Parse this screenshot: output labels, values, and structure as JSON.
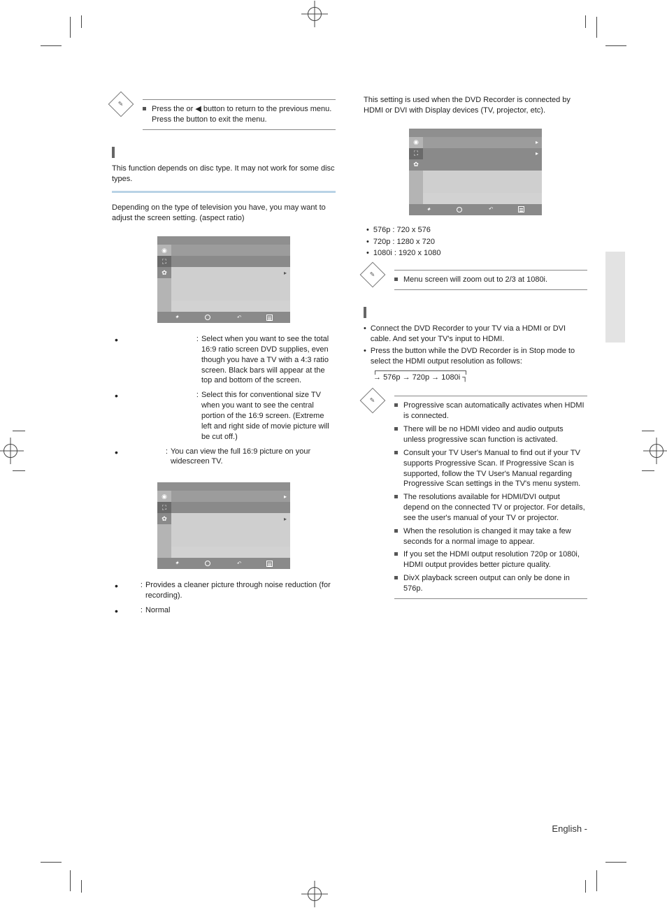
{
  "note1": {
    "item1_a": "Press the ",
    "item1_b": " or ◀ button to return to the previous menu. Press the ",
    "item1_c": " button to exit the menu."
  },
  "section2": {
    "title": "",
    "body": "This function depends on disc type. It may not work for some disc types."
  },
  "aspect": {
    "title": "",
    "intro": "Depending on the type of television you have, you may want to adjust the screen setting. (aspect ratio)",
    "osd": {
      "header": "",
      "rows": [
        {
          "label": "",
          "val": "",
          "hl": true
        },
        {
          "label": "",
          "val": "",
          "sub": true
        },
        {
          "label": "",
          "val": "",
          "arrow": true
        }
      ],
      "hints": {
        "move": "",
        "sel": "",
        "ret": "",
        "exit": ""
      }
    },
    "defs": [
      {
        "t": "",
        "d": "Select when you want to see the total 16:9 ratio screen DVD supplies, even though you have a TV with a 4:3 ratio screen. Black bars will appear at the top and bottom of the screen."
      },
      {
        "t": "",
        "d": "Select this for conventional size TV when you want to see the central portion of the 16:9 screen. (Extreme left and right side of movie picture will be cut off.)"
      },
      {
        "t": "",
        "d": "You can view the full 16:9 picture on your widescreen TV."
      }
    ]
  },
  "nr": {
    "osd": {
      "rows": [
        {
          "label": "",
          "val": "",
          "arrow": true
        },
        {
          "label": "",
          "val": ""
        },
        {
          "label": "",
          "val": "",
          "arrow": true
        }
      ]
    },
    "defs": [
      {
        "t": "",
        "d": "Provides a cleaner picture through noise reduction (for recording)."
      },
      {
        "t": "",
        "d": "Normal"
      }
    ]
  },
  "rightTop": {
    "intro": "This setting is used when the DVD Recorder is connected by HDMI or DVI with Display devices (TV, projector, etc).",
    "osd_rows": [],
    "reslist": [
      "576p : 720 x 576",
      "720p : 1280 x 720",
      "1080i : 1920 x 1080"
    ]
  },
  "note2": "Menu screen will zoom out to 2/3 at 1080i.",
  "hdmi": {
    "title": "",
    "b1": "Connect the DVD Recorder to your TV via a HDMI or DVI cable. And set your TV's input to HDMI.",
    "b2_a": "Press the ",
    "b2_b": " button while the DVD Recorder is in Stop mode to select the HDMI output resolution as follows:",
    "chain": "576p → 720p → 1080i"
  },
  "note3": [
    "Progressive scan automatically activates when HDMI is connected.",
    "There will be no HDMI video and audio outputs unless progressive scan function is activated.",
    "Consult your TV User's Manual to find out if your TV supports Progressive Scan. If Progressive Scan is supported, follow the TV User's Manual regarding Progressive Scan settings in the TV's menu system.",
    "The resolutions available for HDMI/DVI output depend on the connected TV or projector. For details, see the user's manual of your TV or projector.",
    "When the resolution is changed it may take a few seconds for a normal image to appear.",
    "If you set the HDMI output resolution 720p or 1080i, HDMI output provides better picture quality.",
    "DivX playback screen output can only be done in 576p."
  ],
  "footer": {
    "lang": "English -",
    "page": ""
  }
}
